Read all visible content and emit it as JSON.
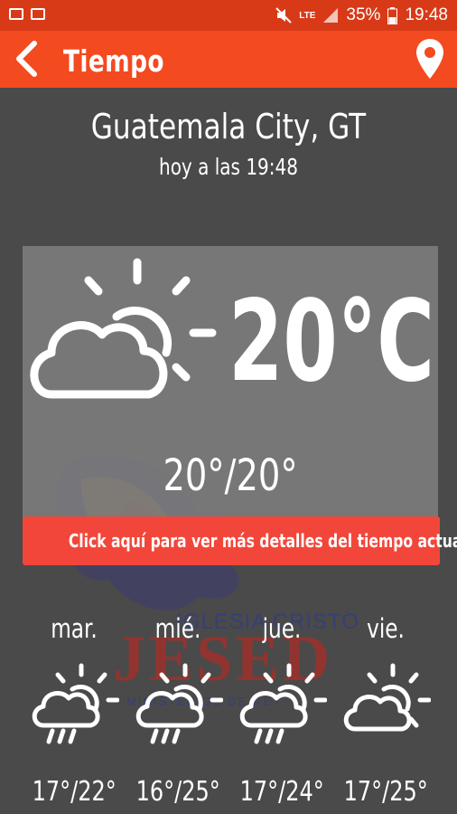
{
  "status_bar": {
    "battery": "35%",
    "clock": "19:48",
    "network": "LTE"
  },
  "app_bar": {
    "title": "Tiempo",
    "back_icon": "chevron-left-icon",
    "location_icon": "map-pin-icon"
  },
  "location": {
    "city": "Guatemala City, GT",
    "updated": "hoy a las 19:48"
  },
  "current": {
    "icon": "partly-cloudy-icon",
    "temperature": "20°C",
    "range": "20°/20°"
  },
  "details_banner": {
    "label": "Click aquí para ver más detalles del tiempo actual."
  },
  "forecast": [
    {
      "day": "mar.",
      "icon": "rain-cloud-sun-icon",
      "range": "17°/22°"
    },
    {
      "day": "mié.",
      "icon": "rain-cloud-sun-icon",
      "range": "16°/25°"
    },
    {
      "day": "jue.",
      "icon": "rain-cloud-sun-icon",
      "range": "17°/24°"
    },
    {
      "day": "vie.",
      "icon": "partly-cloudy-icon",
      "range": "17°/25°"
    }
  ],
  "watermark": {
    "line1": "IGLESIA CRISTO",
    "line2": "JESED",
    "line3": "MINISTERIOS DE REY"
  },
  "colors": {
    "status_bar": "#d83a18",
    "app_bar": "#f34a1f",
    "banner": "#f2463a",
    "background": "#4a4a4a"
  }
}
